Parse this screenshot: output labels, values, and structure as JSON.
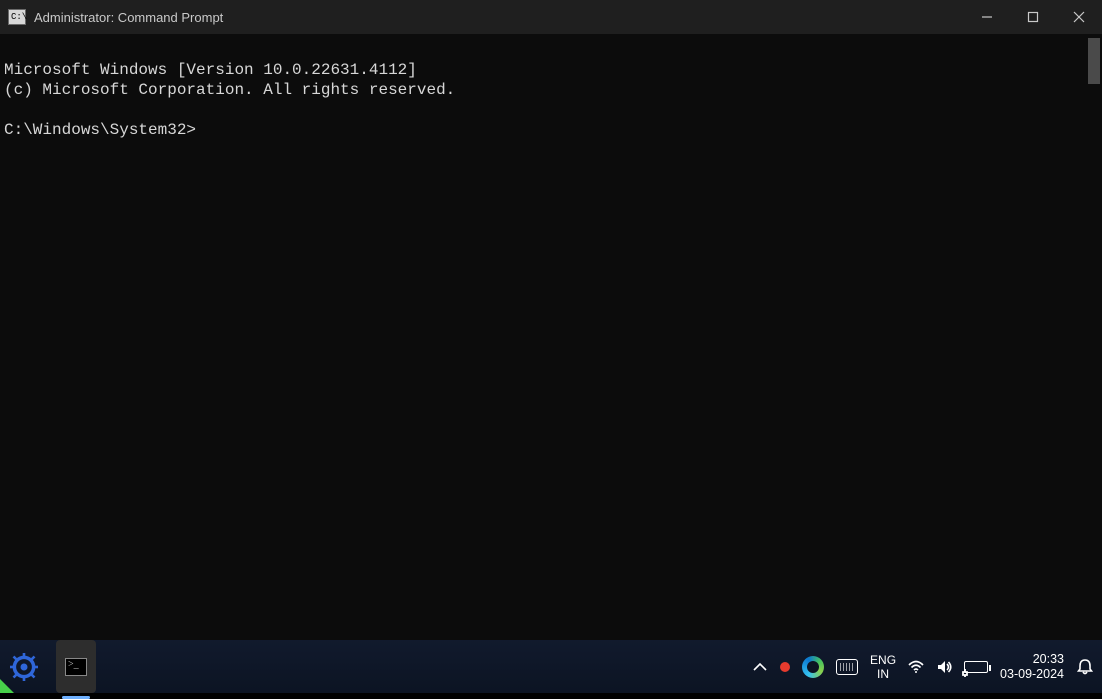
{
  "window": {
    "title": "Administrator: Command Prompt",
    "icon_glyph": "C:\\"
  },
  "terminal": {
    "line1": "Microsoft Windows [Version 10.0.22631.4112]",
    "line2": "(c) Microsoft Corporation. All rights reserved.",
    "prompt": "C:\\Windows\\System32>"
  },
  "taskbar": {
    "lang_top": "ENG",
    "lang_bottom": "IN",
    "time": "20:33",
    "date": "03-09-2024"
  }
}
